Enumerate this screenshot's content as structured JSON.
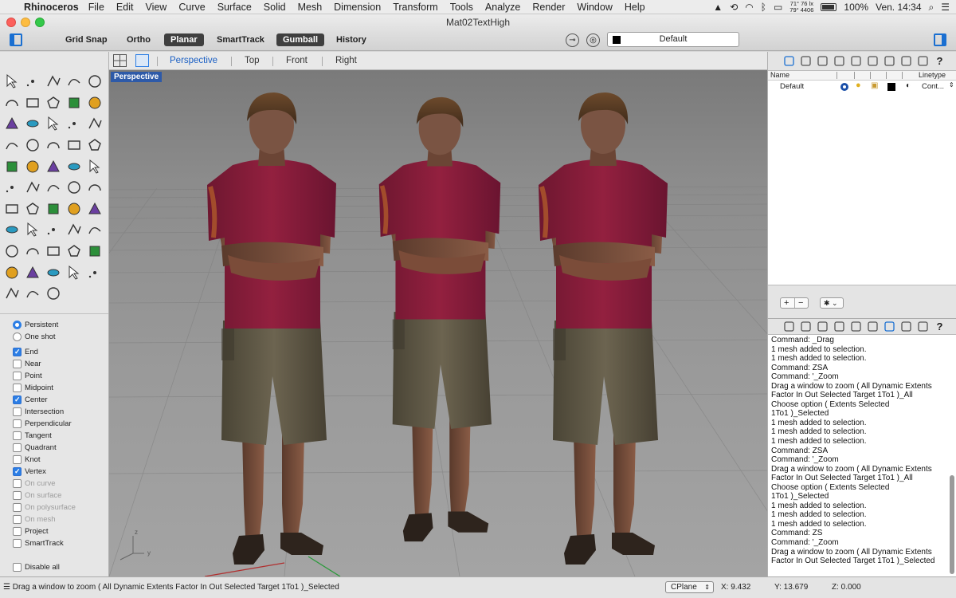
{
  "menubar": {
    "app_name": "Rhinoceros",
    "items": [
      "File",
      "Edit",
      "View",
      "Curve",
      "Surface",
      "Solid",
      "Mesh",
      "Dimension",
      "Transform",
      "Tools",
      "Analyze",
      "Render",
      "Window",
      "Help"
    ],
    "temperature_top": "71° 76 lx",
    "temperature_bottom": "79° 4406",
    "battery": "100%",
    "clock": "Ven. 14:34"
  },
  "window": {
    "title": "Mat02TextHigh"
  },
  "toolbar": {
    "grid_snap": "Grid Snap",
    "ortho": "Ortho",
    "planar": "Planar",
    "smarttrack": "SmartTrack",
    "gumball": "Gumball",
    "history": "History",
    "current_layer": "Default"
  },
  "viewport_tabs": {
    "perspective": "Perspective",
    "top": "Top",
    "front": "Front",
    "right": "Right",
    "active": "Perspective"
  },
  "viewport": {
    "label": "Perspective",
    "axis_z": "z",
    "axis_y": "y"
  },
  "osnap": {
    "mode_persistent": "Persistent",
    "mode_one_shot": "One shot",
    "items": [
      {
        "label": "End",
        "checked": true,
        "enabled": true
      },
      {
        "label": "Near",
        "checked": false,
        "enabled": true
      },
      {
        "label": "Point",
        "checked": false,
        "enabled": true
      },
      {
        "label": "Midpoint",
        "checked": false,
        "enabled": true
      },
      {
        "label": "Center",
        "checked": true,
        "enabled": true
      },
      {
        "label": "Intersection",
        "checked": false,
        "enabled": true
      },
      {
        "label": "Perpendicular",
        "checked": false,
        "enabled": true
      },
      {
        "label": "Tangent",
        "checked": false,
        "enabled": true
      },
      {
        "label": "Quadrant",
        "checked": false,
        "enabled": true
      },
      {
        "label": "Knot",
        "checked": false,
        "enabled": true
      },
      {
        "label": "Vertex",
        "checked": true,
        "enabled": true
      },
      {
        "label": "On curve",
        "checked": false,
        "enabled": false
      },
      {
        "label": "On surface",
        "checked": false,
        "enabled": false
      },
      {
        "label": "On polysurface",
        "checked": false,
        "enabled": false
      },
      {
        "label": "On mesh",
        "checked": false,
        "enabled": false
      },
      {
        "label": "Project",
        "checked": false,
        "enabled": true
      },
      {
        "label": "SmartTrack",
        "checked": false,
        "enabled": true
      }
    ],
    "disable_all": "Disable all"
  },
  "layers": {
    "col_name": "Name",
    "col_linetype": "Linetype",
    "rows": [
      {
        "name": "Default",
        "linetype": "Cont..."
      }
    ]
  },
  "command_history": [
    "Command: _Drag",
    "1 mesh added to selection.",
    "1 mesh added to selection.",
    "Command: ZSA",
    "Command: '_Zoom",
    "Drag a window to zoom ( All Dynamic Extents",
    "Factor In Out Selected Target 1To1 )_All",
    "Choose option ( Extents Selected",
    "1To1 )_Selected",
    "1 mesh added to selection.",
    "1 mesh added to selection.",
    "1 mesh added to selection.",
    "Command: ZSA",
    "Command: '_Zoom",
    "Drag a window to zoom ( All Dynamic Extents",
    "Factor In Out Selected Target 1To1 )_All",
    "Choose option ( Extents Selected",
    "1To1 )_Selected",
    "1 mesh added to selection.",
    "1 mesh added to selection.",
    "1 mesh added to selection.",
    "Command: ZS",
    "Command: '_Zoom",
    "Drag a window to zoom ( All Dynamic Extents",
    "Factor In Out Selected Target 1To1 )_Selected"
  ],
  "statusbar": {
    "prompt": "Drag a window to zoom ( All Dynamic Extents Factor In Out Selected Target 1To1 )_Selected",
    "cplane": "CPlane",
    "x": "X: 9.432",
    "y": "Y: 13.679",
    "z": "Z: 0.000"
  },
  "colors": {
    "accent": "#2c7ee5",
    "viewport_label_bg": "#2e5aa8",
    "shirt": "#8a1c3c",
    "shorts": "#5c5443"
  },
  "icons": {
    "left_toolbar": [
      "select-arrow-icon",
      "point-icon",
      "polyline-icon",
      "curve-icon",
      "circle-icon",
      "arc-icon",
      "freeform-curve-icon",
      "rectangle-icon",
      "polygon-icon",
      "fillet-curve-icon",
      "surface-icon",
      "extrude-icon",
      "box-icon",
      "sphere-icon",
      "cylinder-icon",
      "mesh-icon",
      "explode-icon",
      "trim-icon",
      "split-icon",
      "join-icon",
      "group-icon",
      "boolean-icon",
      "rotate-icon",
      "scale-icon",
      "dimension-icon",
      "move-icon",
      "array-icon",
      "mirror-icon",
      "solid-edit-icon",
      "text-icon",
      "grid-icon",
      "lamp-icon",
      "layer-icon",
      "check-icon",
      "hide-icon",
      "snap-icon",
      "zoom-icon",
      "zoom-window-icon",
      "zoom-extents-icon",
      "light-icon",
      "transform-icon",
      "car-icon",
      "render-mesh-icon",
      "points-icon",
      "bulb-icon",
      "lock-icon",
      "sheet-icon",
      "color-wheel-icon",
      "half-sphere-icon",
      "sphere-grid-icon",
      "render-sphere-icon",
      "cone-icon",
      "cplane-icon"
    ]
  }
}
